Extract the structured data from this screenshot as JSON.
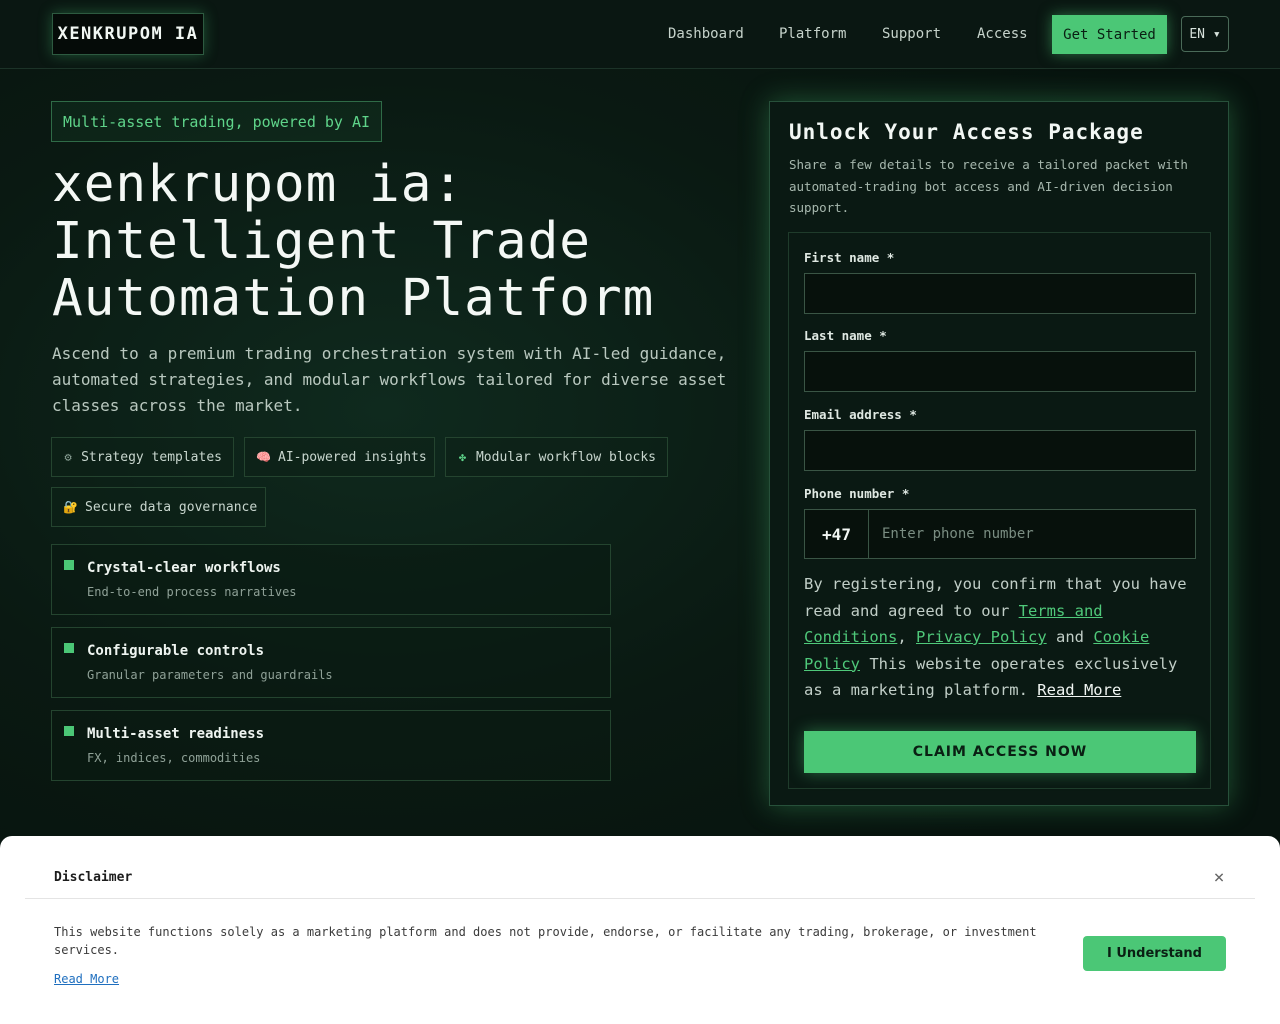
{
  "header": {
    "logo": "XENKRUPOM IA",
    "nav": [
      "Dashboard",
      "Platform",
      "Support",
      "Access"
    ],
    "cta": "Get Started",
    "lang": "EN ▾"
  },
  "hero": {
    "badge": "Multi-asset trading, powered by AI",
    "title": "xenkrupom ia: Intelligent Trade Automation Platform",
    "lead": "Ascend to a premium trading orchestration system with AI-led guidance, automated strategies, and modular workflows tailored for diverse asset classes across the market.",
    "chips": [
      {
        "icon": "⚙",
        "label": "Strategy templates"
      },
      {
        "icon": "🧠",
        "label": "AI-powered insights"
      },
      {
        "icon": "✤",
        "label": "Modular workflow blocks"
      },
      {
        "icon": "🔐",
        "label": "Secure data governance"
      }
    ],
    "features": [
      {
        "title": "Crystal-clear workflows",
        "sub": "End-to-end process narratives"
      },
      {
        "title": "Configurable controls",
        "sub": "Granular parameters and guardrails"
      },
      {
        "title": "Multi-asset readiness",
        "sub": "FX, indices, commodities"
      }
    ]
  },
  "form": {
    "title": "Unlock Your Access Package",
    "subtitle": "Share a few details to receive a tailored packet with automated-trading bot access and AI-driven decision support.",
    "first_name_label": "First name *",
    "last_name_label": "Last name *",
    "email_label": "Email address *",
    "phone_label": "Phone number *",
    "phone_code": "+47",
    "phone_placeholder": "Enter phone number",
    "consent_pre": "By registering, you confirm that you have read and agreed to our ",
    "terms": "Terms and Conditions",
    "comma": ", ",
    "privacy": "Privacy Policy",
    "and": " and ",
    "cookie": "Cookie Policy",
    "consent_post": " This website operates exclusively as a marketing platform. ",
    "read_more": "Read More",
    "submit": "CLAIM ACCESS NOW"
  },
  "disclaimer": {
    "title": "Disclaimer",
    "text": "This website functions solely as a marketing platform and does not provide, endorse, or facilitate any trading, brokerage, or investment services.",
    "read_more": "Read More",
    "button": "I Understand",
    "close": "×"
  }
}
